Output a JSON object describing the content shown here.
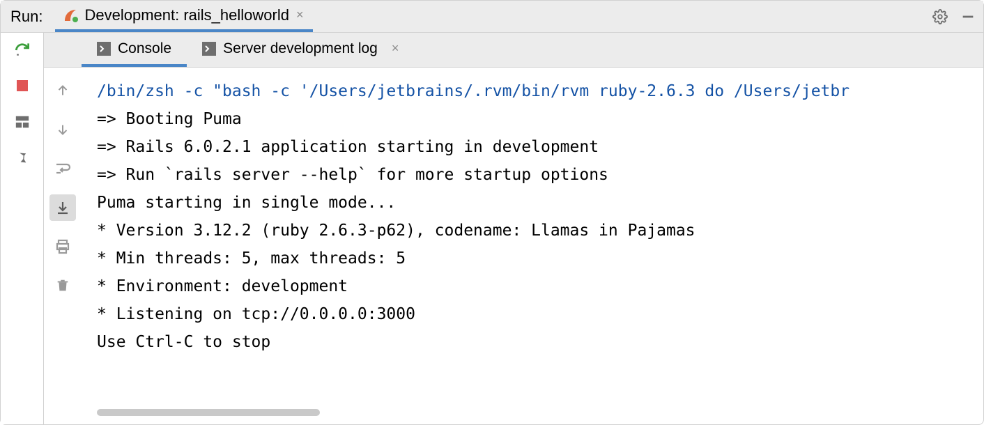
{
  "header": {
    "panel_label": "Run:",
    "run_config_title": "Development: rails_helloworld"
  },
  "subtabs": {
    "console_label": "Console",
    "server_log_label": "Server development log"
  },
  "console": {
    "command_line": "/bin/zsh -c \"bash -c '/Users/jetbrains/.rvm/bin/rvm ruby-2.6.3 do /Users/jetbr",
    "lines": [
      "=> Booting Puma",
      "=> Rails 6.0.2.1 application starting in development ",
      "=> Run `rails server --help` for more startup options",
      "Puma starting in single mode...",
      "* Version 3.12.2 (ruby 2.6.3-p62), codename: Llamas in Pajamas",
      "* Min threads: 5, max threads: 5",
      "* Environment: development",
      "* Listening on tcp://0.0.0.0:3000",
      "Use Ctrl-C to stop"
    ]
  },
  "icons": {
    "settings": "settings-icon",
    "minimize": "minimize-icon",
    "rerun": "rerun-icon",
    "stop": "stop-icon",
    "layout": "layout-icon",
    "pin": "pin-icon",
    "up": "arrow-up-icon",
    "down": "arrow-down-icon",
    "wrap": "soft-wrap-icon",
    "scroll_end": "scroll-to-end-icon",
    "print": "print-icon",
    "trash": "trash-icon",
    "rails": "rails-icon",
    "terminal": "terminal-icon"
  }
}
